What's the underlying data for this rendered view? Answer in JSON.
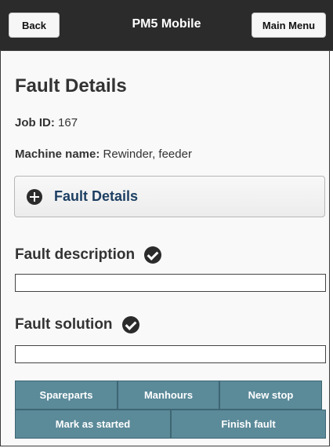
{
  "header": {
    "back_label": "Back",
    "title": "PM5 Mobile",
    "main_menu_label": "Main Menu"
  },
  "page": {
    "title": "Fault Details",
    "job_id_label": "Job ID:",
    "job_id_value": "167",
    "machine_label": "Machine name:",
    "machine_value": "Rewinder, feeder"
  },
  "collapsible": {
    "label": "Fault Details",
    "icon": "plus-circle-icon"
  },
  "fault_description": {
    "label": "Fault description",
    "icon": "check-circle-icon",
    "value": ""
  },
  "fault_solution": {
    "label": "Fault solution",
    "icon": "check-circle-icon",
    "value": ""
  },
  "actions": {
    "spareparts": "Spareparts",
    "manhours": "Manhours",
    "new_stop": "New stop",
    "mark_as_started": "Mark as started",
    "finish_fault": "Finish fault"
  },
  "colors": {
    "header_bg": "#2b2b2b",
    "button_teal": "#5b8a99",
    "link_blue": "#1d3f63"
  }
}
